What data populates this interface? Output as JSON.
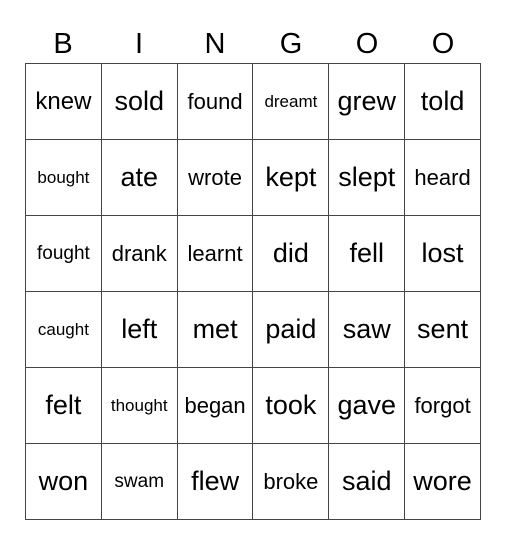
{
  "header": [
    "B",
    "I",
    "N",
    "G",
    "O",
    "O"
  ],
  "rows": [
    [
      {
        "w": "knew",
        "s": "s2"
      },
      {
        "w": "sold",
        "s": "s1"
      },
      {
        "w": "found",
        "s": "s3"
      },
      {
        "w": "dreamt",
        "s": "s5"
      },
      {
        "w": "grew",
        "s": "s1"
      },
      {
        "w": "told",
        "s": "s1"
      }
    ],
    [
      {
        "w": "bought",
        "s": "s5"
      },
      {
        "w": "ate",
        "s": "s1"
      },
      {
        "w": "wrote",
        "s": "s3"
      },
      {
        "w": "kept",
        "s": "s1"
      },
      {
        "w": "slept",
        "s": "s1"
      },
      {
        "w": "heard",
        "s": "s3"
      }
    ],
    [
      {
        "w": "fought",
        "s": "s4"
      },
      {
        "w": "drank",
        "s": "s3"
      },
      {
        "w": "learnt",
        "s": "s3"
      },
      {
        "w": "did",
        "s": "s1"
      },
      {
        "w": "fell",
        "s": "s1"
      },
      {
        "w": "lost",
        "s": "s1"
      }
    ],
    [
      {
        "w": "caught",
        "s": "s5"
      },
      {
        "w": "left",
        "s": "s1"
      },
      {
        "w": "met",
        "s": "s1"
      },
      {
        "w": "paid",
        "s": "s1"
      },
      {
        "w": "saw",
        "s": "s1"
      },
      {
        "w": "sent",
        "s": "s1"
      }
    ],
    [
      {
        "w": "felt",
        "s": "s1"
      },
      {
        "w": "thought",
        "s": "s5"
      },
      {
        "w": "began",
        "s": "s3"
      },
      {
        "w": "took",
        "s": "s1"
      },
      {
        "w": "gave",
        "s": "s1"
      },
      {
        "w": "forgot",
        "s": "s3"
      }
    ],
    [
      {
        "w": "won",
        "s": "s1"
      },
      {
        "w": "swam",
        "s": "s4"
      },
      {
        "w": "flew",
        "s": "s1"
      },
      {
        "w": "broke",
        "s": "s3"
      },
      {
        "w": "said",
        "s": "s1"
      },
      {
        "w": "wore",
        "s": "s1"
      }
    ]
  ]
}
